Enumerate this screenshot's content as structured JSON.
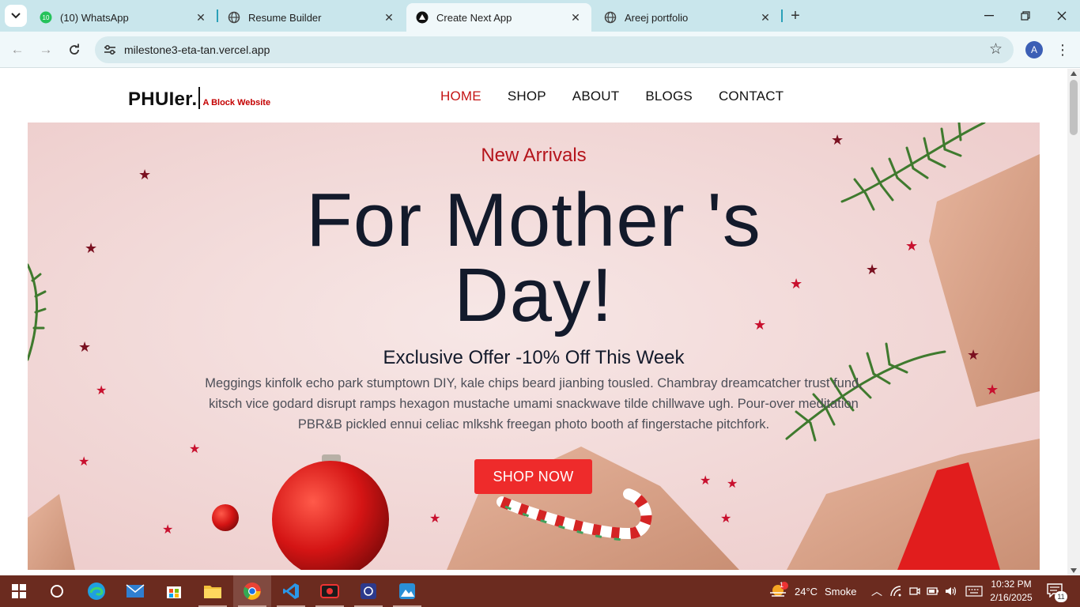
{
  "browser": {
    "tabs": [
      {
        "title": "(10) WhatsApp",
        "badge": "10",
        "icon": "whatsapp-icon"
      },
      {
        "title": "Resume Builder",
        "icon": "globe-icon"
      },
      {
        "title": "Create Next App",
        "icon": "nextjs-icon",
        "active": true
      },
      {
        "title": "Areej portfolio",
        "icon": "globe-icon"
      }
    ],
    "url": "milestone3-eta-tan.vercel.app",
    "profile_initial": "A"
  },
  "site": {
    "brand_name": "PHUIer.",
    "brand_tagline": "A Block Website",
    "nav": [
      {
        "label": "HOME",
        "active": true
      },
      {
        "label": "SHOP"
      },
      {
        "label": "ABOUT"
      },
      {
        "label": "BLOGS"
      },
      {
        "label": "CONTACT"
      }
    ],
    "hero": {
      "kicker": "New Arrivals",
      "headline_line1": "For Mother 's",
      "headline_line2": "Day!",
      "subhead": "Exclusive Offer -10% Off This Week",
      "description": "Meggings kinfolk echo park stumptown DIY, kale chips beard jianbing tousled. Chambray dreamcatcher trust fund, kitsch vice godard disrupt ramps hexagon mustache umami snackwave tilde chillwave ugh. Pour-over meditation PBR&B pickled ennui celiac mlkshk freegan photo booth af fingerstache pitchfork.",
      "cta": "SHOP NOW"
    },
    "colors": {
      "accent": "#ee2b2b",
      "nav_active": "#c41414",
      "headline": "#131a2b"
    }
  },
  "taskbar": {
    "weather_temp": "24°C",
    "weather_text": "Smoke",
    "weather_badge": "1",
    "time": "10:32 PM",
    "date": "2/16/2025",
    "notification_count": "11"
  }
}
